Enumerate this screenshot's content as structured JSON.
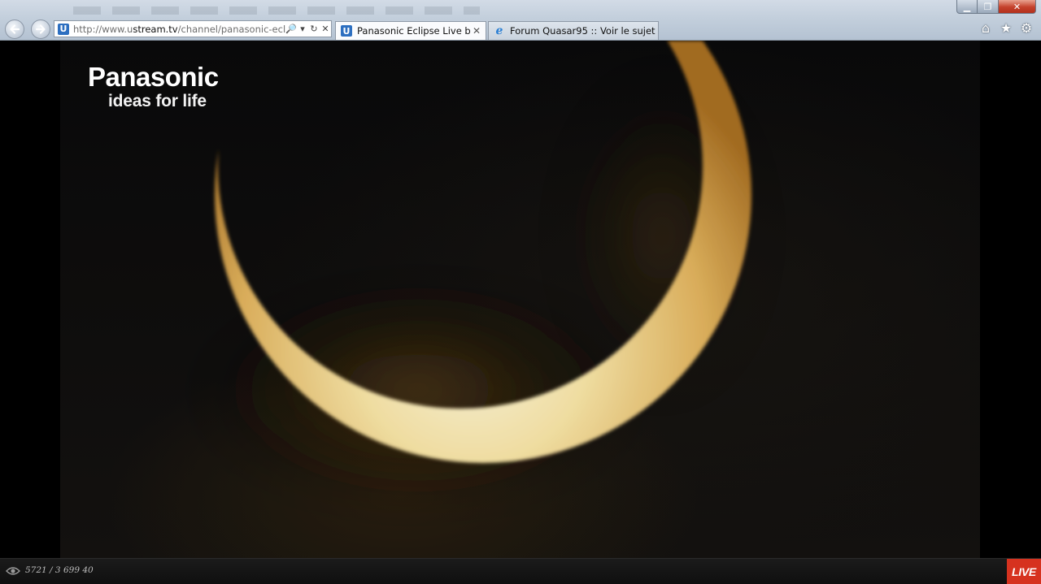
{
  "browser": {
    "address_bar": {
      "favicon_letter": "U",
      "url_prefix": "http://www.u",
      "url_domain": "stream.tv",
      "url_suffix": "/channel/panasonic-eclipse",
      "search_icon": "🔎",
      "dropdown_icon": "▾",
      "refresh_icon": "↻",
      "stop_icon": "✕"
    },
    "tabs": [
      {
        "favicon_letter": "U",
        "title": "Panasonic Eclipse Live by S...",
        "close": "✕",
        "active": true
      },
      {
        "favicon": "ℯ",
        "title": "Forum Quasar95 :: Voir le sujet ...",
        "active": false
      }
    ],
    "nav": {
      "back_icon": "←",
      "forward_icon": "→"
    },
    "window_controls": {
      "minimize": "▁",
      "restore": "❐",
      "close": "✕"
    },
    "toolbar_icons": {
      "home": "⌂",
      "favorites": "★",
      "tools": "⚙"
    }
  },
  "video": {
    "brand_name": "Panasonic",
    "brand_tagline": "ideas for life"
  },
  "player": {
    "viewer_count": "5721 / 3 699 40",
    "live_label": "LIVE"
  },
  "colors": {
    "live_badge": "#d6321f",
    "chrome_bg": "#c3cfdc",
    "crescent_core": "#fff6d0",
    "crescent_edge": "#d49a35"
  }
}
